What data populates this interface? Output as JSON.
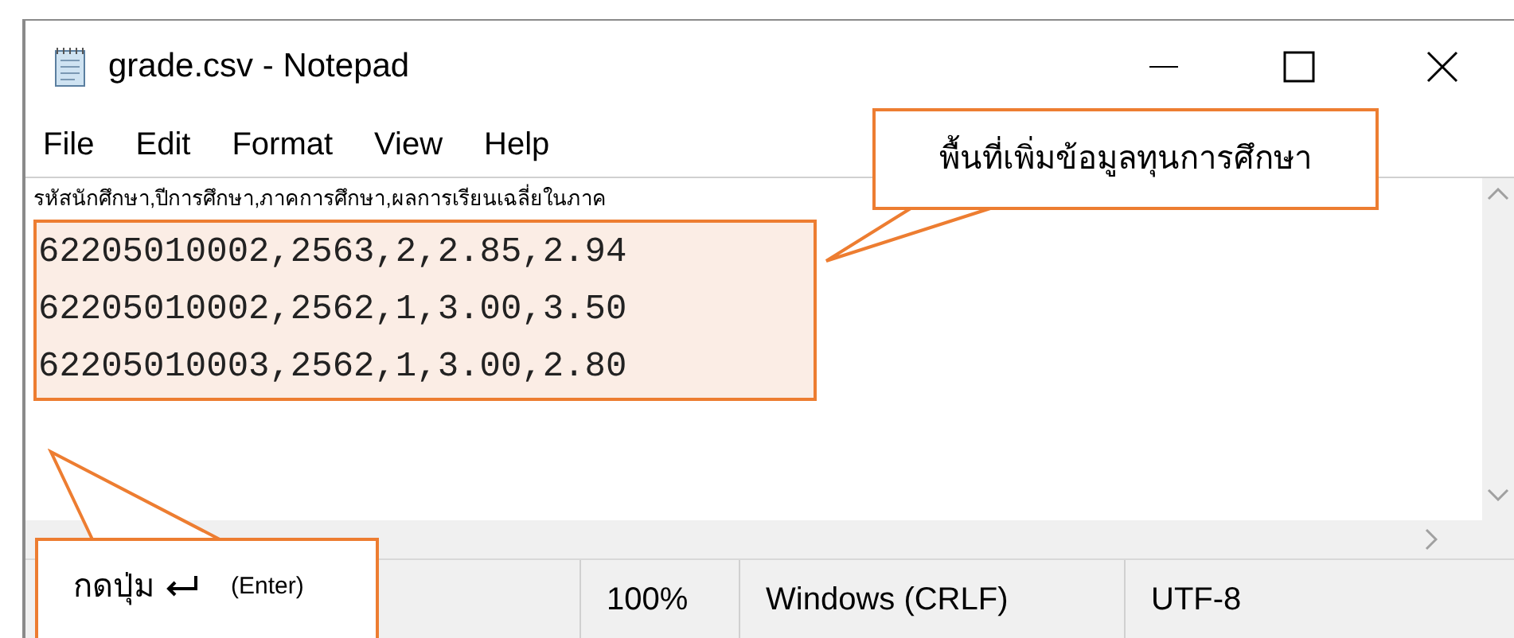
{
  "window": {
    "title": "grade.csv - Notepad"
  },
  "menu": [
    {
      "label": "File"
    },
    {
      "label": "Edit"
    },
    {
      "label": "Format"
    },
    {
      "label": "View"
    },
    {
      "label": "Help"
    }
  ],
  "editor": {
    "lines": [
      "รหัสนักศึกษา,ปีการศึกษา,ภาคการศึกษา,ผลการเรียนเฉลี่ยในภาค"
    ],
    "highlighted_lines": [
      "62205010002,2563,2,2.85,2.94",
      "62205010002,2562,1,3.00,3.50",
      "62205010003,2562,1,3.00,2.80"
    ]
  },
  "status_bar": [
    "100%",
    "Windows (CRLF)",
    "UTF-8"
  ],
  "callouts": [
    {
      "text": "พื้นที่เพิ่มข้อมูลทุนการศึกษา"
    },
    {
      "text": "กดปุ่ม",
      "key_hint": "(Enter)"
    }
  ]
}
